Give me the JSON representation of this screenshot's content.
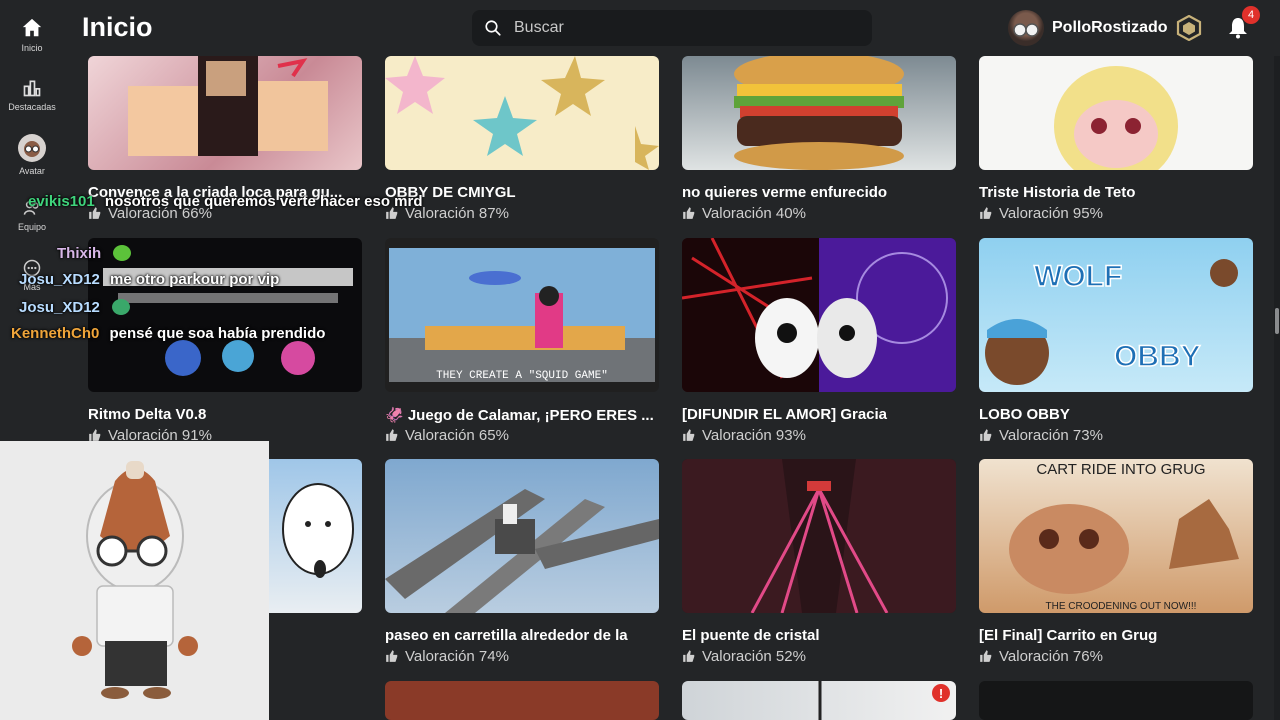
{
  "header": {
    "title": "Inicio",
    "search_placeholder": "Buscar",
    "username": "PolloRostizado",
    "notification_count": "4"
  },
  "sidebar": {
    "items": [
      {
        "label": "Inicio",
        "icon": "home-icon"
      },
      {
        "label": "Destacadas",
        "icon": "charts-icon"
      },
      {
        "label": "Avatar",
        "icon": "avatar-icon"
      },
      {
        "label": "Equipo",
        "icon": "team-icon"
      },
      {
        "label": "Más",
        "icon": "more-icon"
      }
    ]
  },
  "games": [
    {
      "title": "Convence a la criada loca para gu...",
      "rating": "Valoración 66%"
    },
    {
      "title": "OBBY DE CMIYGL",
      "rating": "Valoración 87%"
    },
    {
      "title": "no quieres verme enfurecido",
      "rating": "Valoración 40%"
    },
    {
      "title": "Triste Historia de Teto",
      "rating": "Valoración 95%"
    },
    {
      "title": "Ritmo Delta V0.8",
      "rating": "Valoración 91%"
    },
    {
      "title": "🦑 Juego de Calamar, ¡PERO ERES ...",
      "rating": "Valoración 65%"
    },
    {
      "title": "[DIFUNDIR EL AMOR] Gracia",
      "rating": "Valoración 93%"
    },
    {
      "title": "LOBO OBBY",
      "rating": "Valoración 73%"
    },
    {
      "title": "",
      "rating": ""
    },
    {
      "title": "paseo en carretilla alrededor de la",
      "rating": "Valoración 74%"
    },
    {
      "title": "El puente de cristal",
      "rating": "Valoración 52%"
    },
    {
      "title": "[El Final] Carrito en Grug",
      "rating": "Valoración 76%"
    }
  ],
  "thumb_text": {
    "squid": "THEY CREATE A \"SQUID GAME\"",
    "wolf": "WOLF",
    "obby": "OBBY",
    "grug_top": "CART RIDE INTO GRUG",
    "grug_bottom": "THE CROODENING OUT NOW!!!"
  },
  "chat": [
    {
      "user": "evikis101",
      "message": "nosotros que queremos verte hacer eso mrd",
      "color": "#3fd47c"
    },
    {
      "user": "Thixih",
      "message": "",
      "color": "#d8b7e8"
    },
    {
      "user": "Josu_XD12",
      "message": "me otro parkour por vip",
      "color": "#b8dcff"
    },
    {
      "user": "Josu_XD12",
      "message": "",
      "color": "#b8dcff"
    },
    {
      "user": "KennethCh0",
      "message": "pensé que soa había prendido",
      "color": "#f0a53a"
    }
  ],
  "colors": {
    "background": "#232527",
    "search_bg": "#191b1d",
    "badge": "#e0312b"
  }
}
